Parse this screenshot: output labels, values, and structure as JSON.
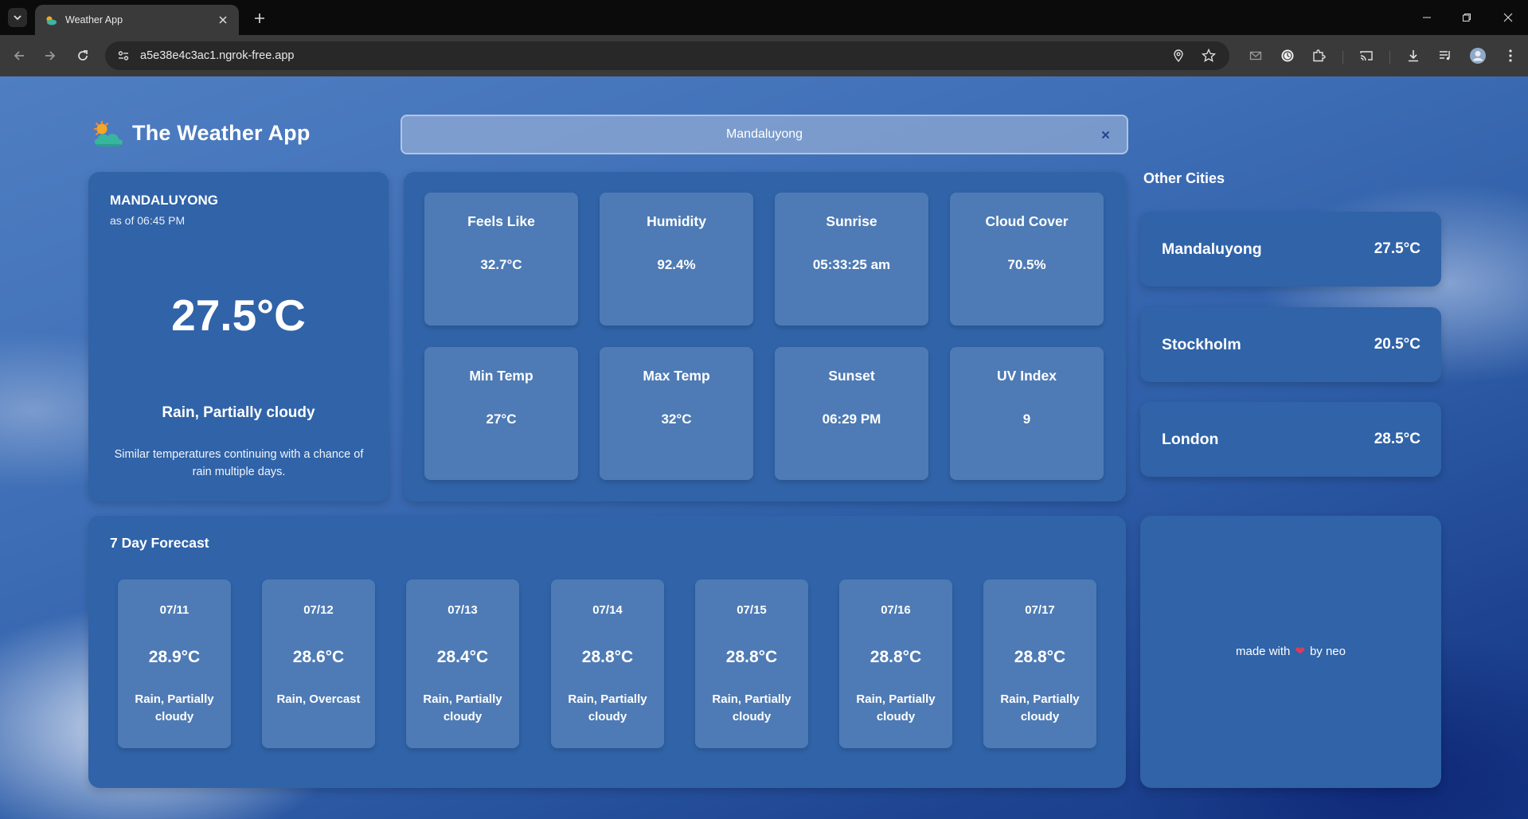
{
  "browser": {
    "tab_title": "Weather App",
    "url": "a5e38e4c3ac1.ngrok-free.app"
  },
  "app": {
    "title": "The Weather App",
    "search_value": "Mandaluyong"
  },
  "current": {
    "city": "MANDALUYONG",
    "as_of": "as of 06:45 PM",
    "temp": "27.5°C",
    "condition": "Rain, Partially cloudy",
    "description": "Similar temperatures continuing with a chance of rain multiple days."
  },
  "details": [
    {
      "label": "Feels Like",
      "value": "32.7°C"
    },
    {
      "label": "Humidity",
      "value": "92.4%"
    },
    {
      "label": "Sunrise",
      "value": "05:33:25 am"
    },
    {
      "label": "Cloud Cover",
      "value": "70.5%"
    },
    {
      "label": "Min Temp",
      "value": "27°C"
    },
    {
      "label": "Max Temp",
      "value": "32°C"
    },
    {
      "label": "Sunset",
      "value": "06:29 PM"
    },
    {
      "label": "UV Index",
      "value": "9"
    }
  ],
  "other_cities": {
    "title": "Other Cities",
    "items": [
      {
        "name": "Mandaluyong",
        "temp": "27.5°C"
      },
      {
        "name": "Stockholm",
        "temp": "20.5°C"
      },
      {
        "name": "London",
        "temp": "28.5°C"
      }
    ]
  },
  "forecast": {
    "title": "7 Day Forecast",
    "days": [
      {
        "date": "07/11",
        "temp": "28.9°C",
        "condition": "Rain, Partially cloudy"
      },
      {
        "date": "07/12",
        "temp": "28.6°C",
        "condition": "Rain, Overcast"
      },
      {
        "date": "07/13",
        "temp": "28.4°C",
        "condition": "Rain, Partially cloudy"
      },
      {
        "date": "07/14",
        "temp": "28.8°C",
        "condition": "Rain, Partially cloudy"
      },
      {
        "date": "07/15",
        "temp": "28.8°C",
        "condition": "Rain, Partially cloudy"
      },
      {
        "date": "07/16",
        "temp": "28.8°C",
        "condition": "Rain, Partially cloudy"
      },
      {
        "date": "07/17",
        "temp": "28.8°C",
        "condition": "Rain, Partially cloudy"
      }
    ]
  },
  "credit": {
    "prefix": "made with",
    "suffix": "by neo",
    "heart_icon": "heart-icon",
    "heart_color": "#e23a5a"
  },
  "colors": {
    "card": "#3063a8",
    "tile": "#4e7bb5",
    "chrome_dark": "#0b0b0b",
    "chrome_toolbar": "#3a3a3a"
  }
}
